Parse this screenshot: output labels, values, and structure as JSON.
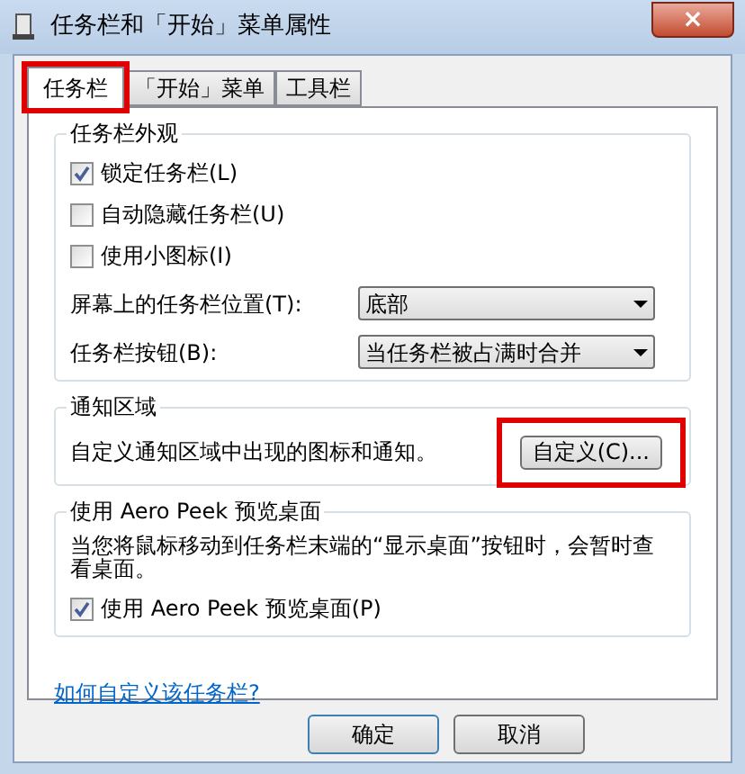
{
  "window": {
    "title": "任务栏和「开始」菜单属性",
    "close": "×"
  },
  "tabs": [
    {
      "label": "任务栏",
      "selected": true,
      "highlighted": true
    },
    {
      "label": "「开始」菜单",
      "selected": false,
      "highlighted": false
    },
    {
      "label": "工具栏",
      "selected": false,
      "highlighted": false
    }
  ],
  "appearance": {
    "title": "任务栏外观",
    "checkboxes": [
      {
        "label": "锁定任务栏(L)",
        "checked": true
      },
      {
        "label": "自动隐藏任务栏(U)",
        "checked": false
      },
      {
        "label": "使用小图标(I)",
        "checked": false
      }
    ],
    "dropdowns": [
      {
        "label": "屏幕上的任务栏位置(T):",
        "value": "底部"
      },
      {
        "label": "任务栏按钮(B):",
        "value": "当任务栏被占满时合并"
      }
    ]
  },
  "notification": {
    "title": "通知区域",
    "text": "自定义通知区域中出现的图标和通知。",
    "button": {
      "label": "自定义(C)...",
      "highlighted": true
    }
  },
  "aero_peek": {
    "title": "使用 Aero Peek 预览桌面",
    "text": "当您将鼠标移动到任务栏末端的“显示桌面”按钮时，会暂时查看桌面。",
    "checkbox": {
      "label": "使用 Aero Peek 预览桌面(P)",
      "checked": true
    }
  },
  "link": "如何自定义该任务栏?",
  "buttons": [
    "确定",
    "取消"
  ]
}
